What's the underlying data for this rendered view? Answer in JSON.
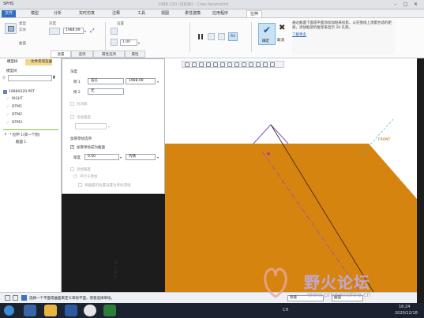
{
  "window": {
    "app_label": "SPHS",
    "title": "1988-320 (活动的) - Creo Parametric",
    "minimize": "–",
    "maximize": "□",
    "close": "✕"
  },
  "menu": {
    "tabs": [
      "文件",
      "模型",
      "分析",
      "实时仿真",
      "注释",
      "工具",
      "视图",
      "柔性建模",
      "应用程序",
      "拉伸"
    ]
  },
  "ribbon": {
    "type_label": "类型",
    "solid_label": "实体",
    "surface_label": "曲面",
    "depth_label": "深度",
    "depth_value": "1988.09",
    "setting_label": "设置",
    "thicken_value": "1.00",
    "pause_label": "暂停",
    "preview_label": "预览",
    "confirm_label": "确定",
    "cancel_label": "取消",
    "help_text": "通过截面下面或平面添加加框来投影。以在图纸上测量合适的距离，添加框架的框架来显示 20 孔距。",
    "learn_more": "了解更多"
  },
  "panel_tabs": [
    "放置",
    "选项",
    "属性选项",
    "属性"
  ],
  "tree": {
    "tab_model": "模型树",
    "tab_layer": "文件夹浏览器",
    "header": "模型树",
    "root": "1988X320.PRT",
    "items": [
      "RIGHT",
      "DTM1",
      "DTM2",
      "DTM3"
    ],
    "feature": "* 拉伸 1(第一个图)",
    "feature_child": "截面 1"
  },
  "panel": {
    "depth_heading": "深度",
    "side1_label": "侧 1",
    "side1_type": "盲孔",
    "side1_value": "1988.09",
    "side2_label": "侧 2",
    "side2_type": "无",
    "option_a": "封闭端",
    "option_b": "添加锥度",
    "thicken_heading": "加厚草绘选项",
    "thicken_check": "加厚草绘成为截面",
    "value_label": "厚度",
    "value": "0.00",
    "direction": "内侧",
    "option_c": "添加锥度",
    "option_d": "平行于草绘",
    "option_e": "将截面的位置设置为草绘或组",
    "sidebar_note": "插入再生"
  },
  "graphics": {
    "edge_label": "FRONT",
    "axis_label": "A_1"
  },
  "status": {
    "message": "选择一个平面或曲面来定义草绘平面，或者选择草绘。",
    "filter_value": "智能",
    "filter_right": "曲面"
  },
  "taskbar": {
    "lang": "CH",
    "time": "16:24",
    "date": "2020/12/18"
  },
  "watermark": {
    "text": "野火论坛",
    "url": "www.proewildfire.cn"
  },
  "colors": {
    "part_fill": "#d68410",
    "file_tab": "#2f6fbe",
    "accent": "#8a4fc0",
    "taskbar": "#1b2230"
  }
}
